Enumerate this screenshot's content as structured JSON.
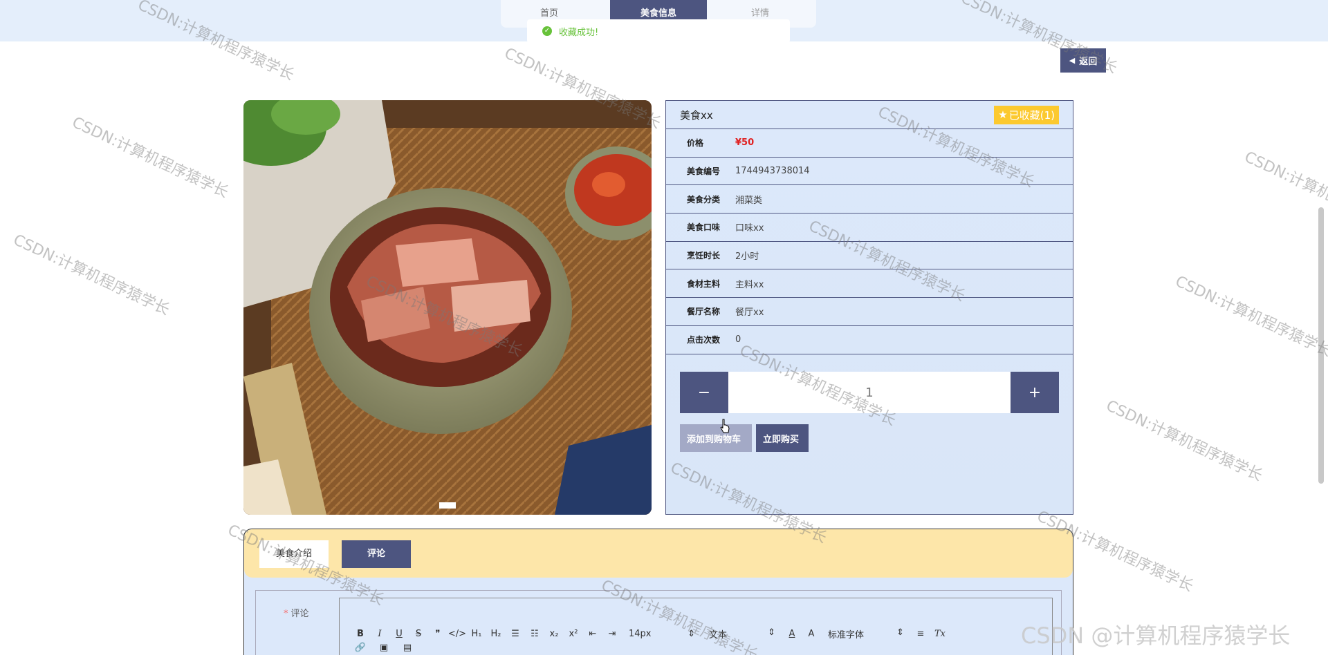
{
  "nav": {
    "home": "首页",
    "active": "美食信息",
    "detail": "详情"
  },
  "toast": {
    "message": "收藏成功!"
  },
  "back_label": "返回",
  "product": {
    "title": "美食xx",
    "favorite_label": "已收藏(1)",
    "rows": [
      {
        "label": "价格",
        "value": "¥50"
      },
      {
        "label": "美食编号",
        "value": "1744943738014"
      },
      {
        "label": "美食分类",
        "value": "湘菜类"
      },
      {
        "label": "美食口味",
        "value": "口味xx"
      },
      {
        "label": "烹饪时长",
        "value": "2小时"
      },
      {
        "label": "食材主料",
        "value": "主料xx"
      },
      {
        "label": "餐厅名称",
        "value": "餐厅xx"
      },
      {
        "label": "点击次数",
        "value": "0"
      }
    ],
    "quantity": "1",
    "minus": "−",
    "plus": "+",
    "add_cart": "添加到购物车",
    "buy_now": "立即购买"
  },
  "tabs": {
    "intro": "美食介绍",
    "comment": "评论"
  },
  "comment": {
    "label": "评论",
    "required_mark": "*",
    "toolbar": {
      "bold": "B",
      "italic": "I",
      "underline": "U",
      "strike": "S",
      "quote": "❞",
      "code": "</>",
      "h1": "H₁",
      "h2": "H₂",
      "ol": "☰",
      "ul": "☷",
      "sub": "x₂",
      "sup": "x²",
      "indent_left": "⇤",
      "indent_right": "⇥",
      "size": "14px",
      "text": "文本",
      "color": "A",
      "bg": "A",
      "font": "标准字体",
      "align": "≡",
      "clear": "Tx",
      "link": "🔗",
      "image": "▣",
      "video": "▤",
      "arrow": "⇕"
    }
  },
  "watermark": "CSDN:计算机程序猿学长",
  "corner_watermark": "CSDN @计算机程序猿学长",
  "colors": {
    "accent": "#4d5580",
    "favorite": "#fcc92f",
    "panel": "#dce8fa",
    "tabbar": "#fde6a9"
  }
}
